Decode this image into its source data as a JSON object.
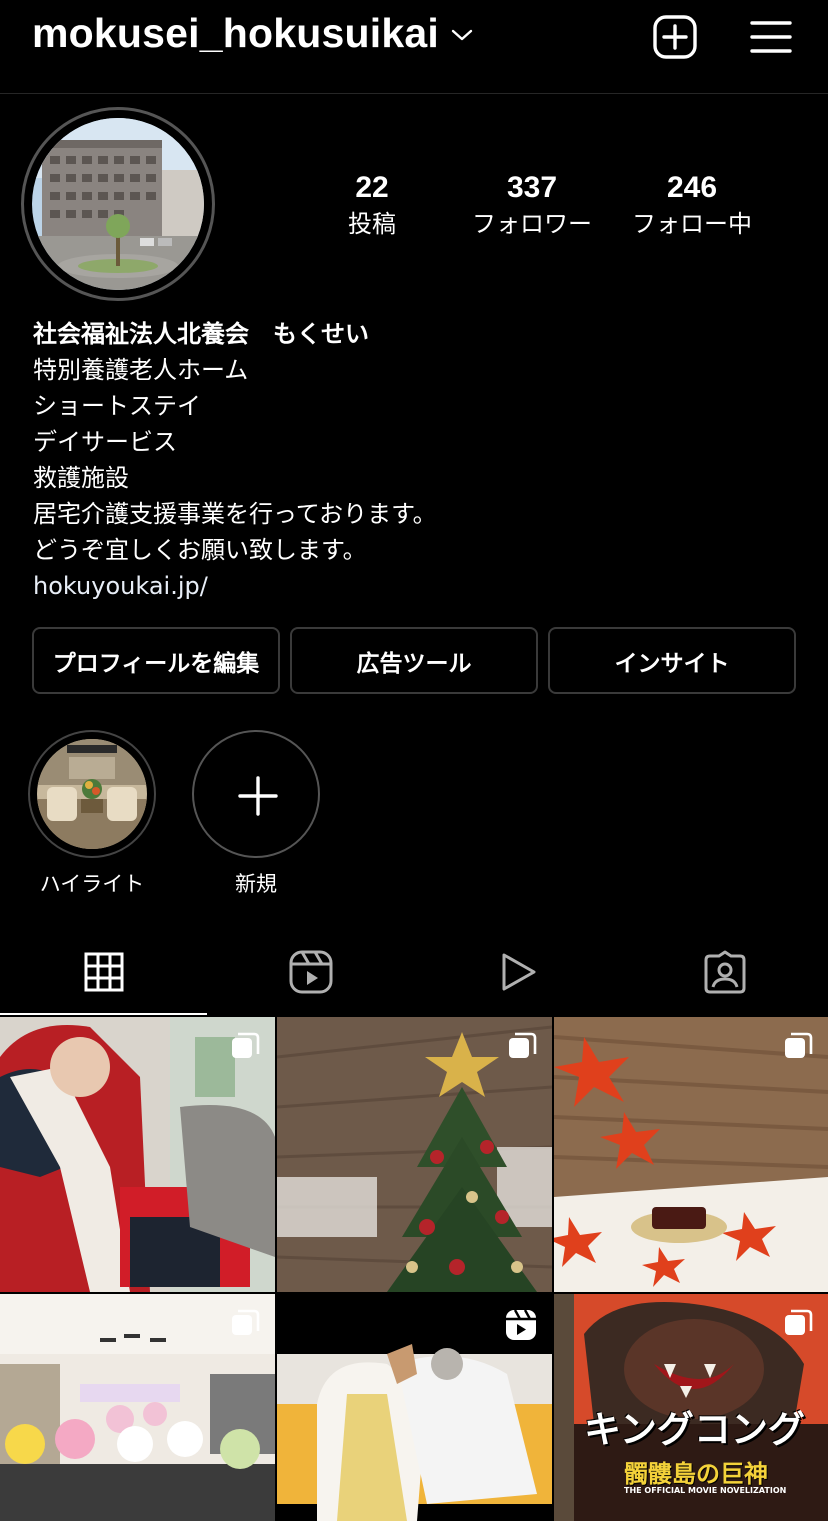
{
  "header": {
    "username": "mokusei_hokusuikai",
    "icons": [
      "chevron-down-icon",
      "new-post-icon",
      "menu-icon"
    ]
  },
  "profile": {
    "stats": [
      {
        "value": "22",
        "label": "投稿"
      },
      {
        "value": "337",
        "label": "フォロワー"
      },
      {
        "value": "246",
        "label": "フォロー中"
      }
    ],
    "name": "社会福祉法人北養会　もくせい",
    "bio_lines": [
      "特別養護老人ホーム",
      "ショートステイ",
      "デイサービス",
      "救護施設",
      "居宅介護支援事業を行っております。",
      "どうぞ宜しくお願い致します。"
    ],
    "link": "hokuyoukai.jp/"
  },
  "buttons": {
    "edit_profile": "プロフィールを編集",
    "ad_tools": "広告ツール",
    "insights": "インサイト"
  },
  "highlights": [
    {
      "label": "ハイライト"
    },
    {
      "label": "新規"
    }
  ],
  "tabs": [
    {
      "name": "grid",
      "icon": "grid-icon",
      "active": true
    },
    {
      "name": "reels",
      "icon": "reels-icon",
      "active": false
    },
    {
      "name": "video",
      "icon": "play-icon",
      "active": false
    },
    {
      "name": "tagged",
      "icon": "tagged-person-icon",
      "active": false
    }
  ],
  "posts": [
    {
      "badge": "carousel-icon"
    },
    {
      "badge": "carousel-icon"
    },
    {
      "badge": "carousel-icon"
    },
    {
      "badge": "carousel-icon"
    },
    {
      "badge": "reels-icon"
    },
    {
      "badge": "carousel-icon",
      "poster_text": "キングコング",
      "poster_subtitle": "髑髏島の巨神",
      "poster_caption": "THE OFFICIAL MOVIE NOVELIZATION"
    }
  ],
  "colors": {
    "background": "#000000",
    "text": "#ffffff",
    "border": "#3a3a3a"
  }
}
